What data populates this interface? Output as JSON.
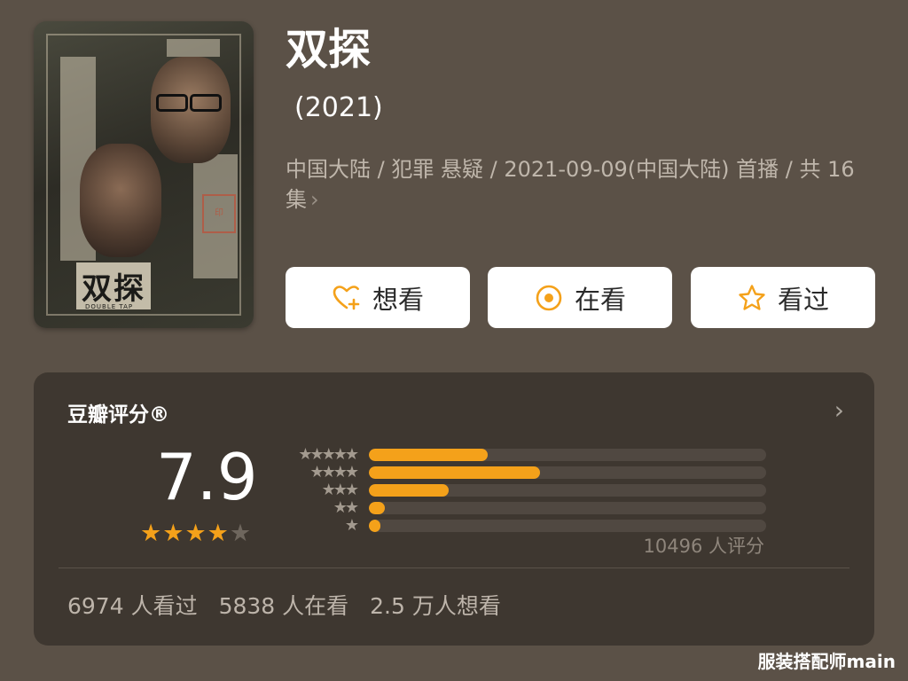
{
  "show": {
    "title": "双探",
    "year": "(2021)",
    "meta": "中国大陆 / 犯罪 悬疑 / 2021-09-09(中国大陆) 首播 / 共 16 集",
    "more_icon": "chevron-right-icon",
    "poster": {
      "logo_text": "双探",
      "sub_text": "DOUBLE TAP"
    }
  },
  "actions": [
    {
      "label": "想看",
      "icon": "heart-plus-icon"
    },
    {
      "label": "在看",
      "icon": "target-icon"
    },
    {
      "label": "看过",
      "icon": "star-outline-icon"
    }
  ],
  "rating": {
    "title": "豆瓣评分®",
    "score": "7.9",
    "stars_filled": 4,
    "stars_total": 5,
    "distribution": [
      {
        "stars": "★★★★★",
        "fraction": 0.3
      },
      {
        "stars": "★★★★",
        "fraction": 0.43
      },
      {
        "stars": "★★★",
        "fraction": 0.2
      },
      {
        "stars": "★★",
        "fraction": 0.04
      },
      {
        "stars": "★",
        "fraction": 0.03
      }
    ],
    "count_text": "10496 人评分",
    "stats": [
      "6974 人看过",
      "5838 人在看",
      "2.5 万人想看"
    ]
  },
  "watermark": "服装搭配师main",
  "colors": {
    "accent": "#f4a11a",
    "background": "#5b5147",
    "card": "#3e3730"
  }
}
